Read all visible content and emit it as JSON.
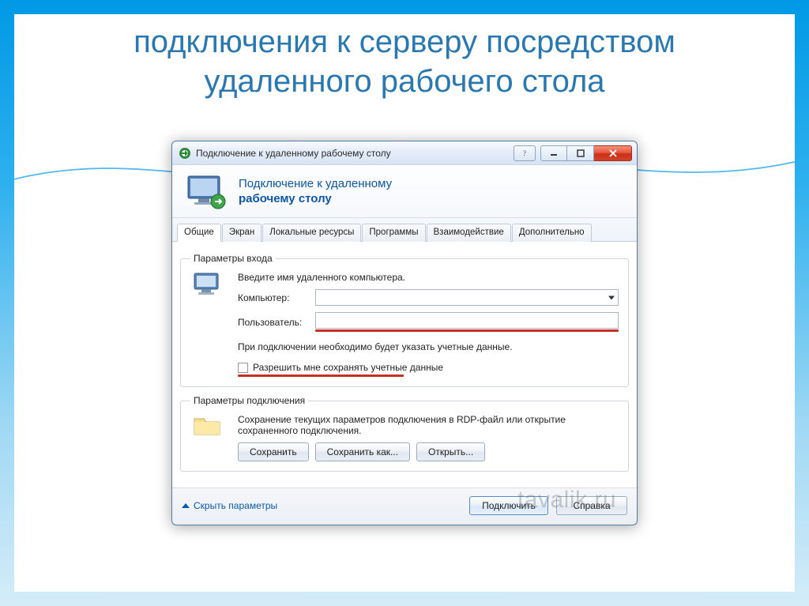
{
  "slide": {
    "heading_line1": "подключения к серверу посредством",
    "heading_line2": "удаленного рабочего стола"
  },
  "window": {
    "title": "Подключение к удаленному рабочему столу",
    "banner_line1": "Подключение к удаленному",
    "banner_line2": "рабочему столу"
  },
  "tabs": [
    {
      "label": "Общие",
      "active": true
    },
    {
      "label": "Экран",
      "active": false
    },
    {
      "label": "Локальные ресурсы",
      "active": false
    },
    {
      "label": "Программы",
      "active": false
    },
    {
      "label": "Взаимодействие",
      "active": false
    },
    {
      "label": "Дополнительно",
      "active": false
    }
  ],
  "login_group": {
    "legend": "Параметры входа",
    "intro": "Введите имя удаленного компьютера.",
    "computer_label": "Компьютер:",
    "computer_value": "",
    "user_label": "Пользователь:",
    "user_value": "",
    "hint": "При подключении необходимо будет указать учетные данные.",
    "checkbox_label": "Разрешить мне сохранять учетные данные"
  },
  "conn_group": {
    "legend": "Параметры подключения",
    "text": "Сохранение текущих параметров подключения в RDP-файл или открытие сохраненного подключения.",
    "save": "Сохранить",
    "save_as": "Сохранить как...",
    "open": "Открыть..."
  },
  "footer": {
    "hide_params": "Скрыть параметры",
    "connect": "Подключить",
    "help": "Справка"
  },
  "watermark": "tavalik.ru"
}
